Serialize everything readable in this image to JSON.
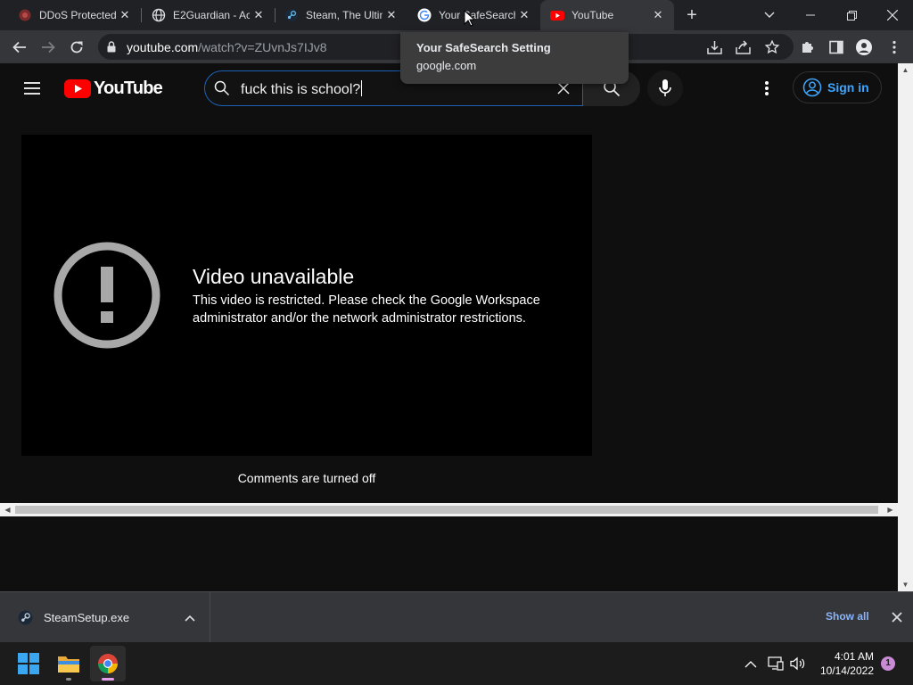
{
  "tabs": [
    {
      "title": "DDoS Protected",
      "icon": "ddos-icon",
      "active": false
    },
    {
      "title": "E2Guardian - Ac",
      "icon": "globe-icon",
      "active": false
    },
    {
      "title": "Steam, The Ultin",
      "icon": "steam-icon",
      "active": false
    },
    {
      "title": "Your SafeSearch",
      "icon": "google-icon",
      "active": false
    },
    {
      "title": "YouTube",
      "icon": "youtube-icon",
      "active": true
    }
  ],
  "tooltip": {
    "title": "Your SafeSearch Setting",
    "domain": "google.com"
  },
  "address_bar": {
    "host": "youtube.com",
    "path": "/watch?v=ZUvnJs7IJv8"
  },
  "youtube": {
    "logo_text": "YouTube",
    "search_value": "fuck this is school?",
    "sign_in_label": "Sign in",
    "error_title": "Video unavailable",
    "error_message": "This video is restricted. Please check the Google Workspace administrator and/or the network administrator restrictions.",
    "comments_status": "Comments are turned off"
  },
  "download_bar": {
    "file_name": "SteamSetup.exe",
    "show_all_label": "Show all"
  },
  "taskbar": {
    "time": "4:01 AM",
    "date": "10/14/2022",
    "notification_count": "1"
  },
  "colors": {
    "youtube_red": "#ff0000",
    "link_blue": "#3ea6ff",
    "chrome_dark": "#202124",
    "toolbar_dark": "#35363a"
  }
}
